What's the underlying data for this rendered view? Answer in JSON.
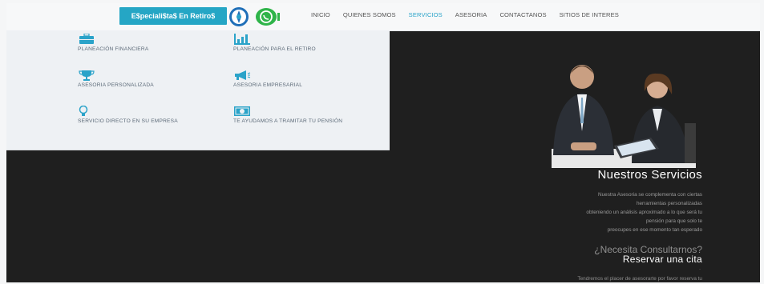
{
  "header": {
    "brand_button": "E$peciali$ta$ En Retiro$",
    "nav": [
      "INICIO",
      "QUIENES SOMOS",
      "SERVICIOS",
      "ASESORIA",
      "CONTACTANOS",
      "SITIOS DE INTERES"
    ],
    "active_nav": "SERVICIOS"
  },
  "services_menu": [
    {
      "label": "PLANEACIÓN FINANCIERA",
      "icon": "briefcase-icon"
    },
    {
      "label": "PLANEACIÓN PARA EL RETIRO",
      "icon": "bar-chart-icon"
    },
    {
      "label": "ASESORIA PERSONALIZADA",
      "icon": "trophy-icon"
    },
    {
      "label": "ASESORIA EMPRESARIAL",
      "icon": "megaphone-icon"
    },
    {
      "label": "SERVICIO DIRECTO EN SU EMPRESA",
      "icon": "lightbulb-icon"
    },
    {
      "label": "TE AYUDAMOS A TRAMITAR TU PENSIÓN",
      "icon": "money-icon"
    }
  ],
  "section": {
    "title": "Nuestros Servicios",
    "description_lines": [
      "Nuestra Asesoria se complementa con ciertas",
      "herramientas personalizadas",
      "obteniendo un análisis aproximado a lo que será tu",
      "pensión para que solo te",
      "preocupes en ese momento tan esperado"
    ],
    "question": "¿Necesita Consultarnos?",
    "cta": "Reservar una cita",
    "dot": "·",
    "footer_text": "Tendremos el placer de asesorarte por favor reserva tu"
  },
  "colors": {
    "accent": "#25a6c5",
    "nav_active": "#2aa3c9",
    "dark_bg": "#1f1f1f",
    "whatsapp": "#2fb44a"
  }
}
